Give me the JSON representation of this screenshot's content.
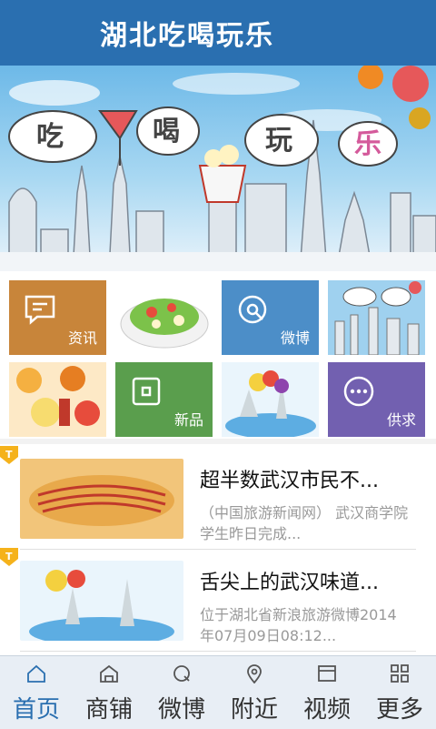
{
  "header": {
    "title": "湖北吃喝玩乐"
  },
  "banner": {
    "letters": [
      "吃",
      "喝",
      "玩",
      "乐"
    ],
    "slide_count": 2
  },
  "tiles": [
    {
      "label": "资讯",
      "color": "#c8853a",
      "icon": "chat-icon"
    },
    {
      "label": "",
      "kind": "salad-photo"
    },
    {
      "label": "微博",
      "color": "#4c8ec8",
      "icon": "weibo-icon"
    },
    {
      "label": "",
      "kind": "city-banner-photo"
    },
    {
      "label": "",
      "kind": "food-collage-photo"
    },
    {
      "label": "新品",
      "color": "#5a9e4d",
      "icon": "square-icon"
    },
    {
      "label": "",
      "kind": "travel-photo"
    },
    {
      "label": "供求",
      "color": "#7260b0",
      "icon": "more-icon"
    }
  ],
  "news": [
    {
      "title": "超半数武汉市民不...",
      "desc": "（中国旅游新闻网） 武汉商学院学生昨日完成..."
    },
    {
      "title": "舌尖上的武汉味道...",
      "desc": "位于湖北省新浪旅游微博2014年07月09日08:12..."
    }
  ],
  "tabs": [
    {
      "label": "首页",
      "icon": "home-icon",
      "active": true
    },
    {
      "label": "商铺",
      "icon": "shop-icon"
    },
    {
      "label": "微博",
      "icon": "weibo-icon"
    },
    {
      "label": "附近",
      "icon": "location-icon"
    },
    {
      "label": "视频",
      "icon": "video-icon"
    },
    {
      "label": "更多",
      "icon": "grid-icon"
    }
  ],
  "colors": {
    "header": "#2a6fb0",
    "active_tab": "#2a6fb0",
    "tag": "#f5b21b"
  }
}
